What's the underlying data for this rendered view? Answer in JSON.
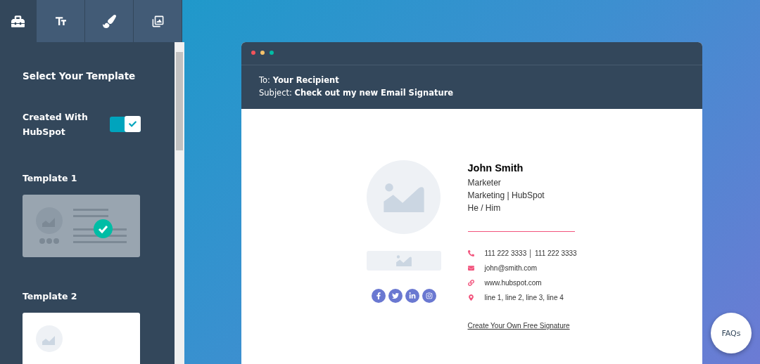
{
  "tabs": [
    {
      "selected": true
    },
    {
      "selected": false
    },
    {
      "selected": false
    },
    {
      "selected": false
    }
  ],
  "sidebar": {
    "title": "Select Your Template",
    "toggle": {
      "label": "Created With HubSpot",
      "on": true
    },
    "templates": [
      {
        "label": "Template 1",
        "selected": true
      },
      {
        "label": "Template 2",
        "selected": false
      }
    ]
  },
  "email": {
    "to_label": "To:",
    "to": "Your Recipient",
    "subject_label": "Subject:",
    "subject": "Check out my new Email Signature",
    "signature": {
      "name": "John Smith",
      "lines": [
        "Marketer",
        "Marketing | HubSpot",
        "He / Him"
      ],
      "contacts": [
        {
          "kind": "phone",
          "text": "111 222 3333 │ 111 222 3333"
        },
        {
          "kind": "email",
          "text": "john@smith.com"
        },
        {
          "kind": "link",
          "text": "www.hubspot.com"
        },
        {
          "kind": "location",
          "text": "line 1, line 2, line 3, line 4"
        }
      ],
      "cta": "Create Your Own Free Signature"
    }
  },
  "faq": "FAQs"
}
